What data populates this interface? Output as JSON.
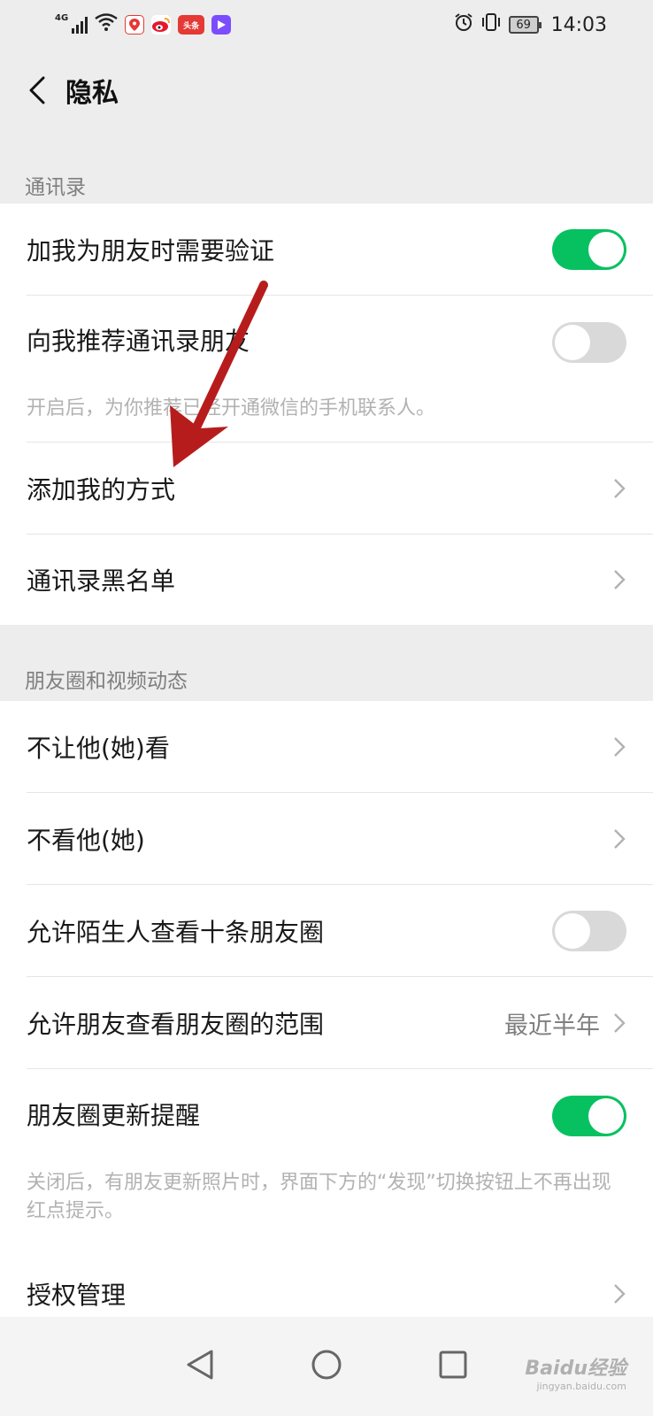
{
  "status_bar": {
    "network": "4G",
    "apps": [
      {
        "icon": "maps-app-icon",
        "color": "#e53935",
        "text": ""
      },
      {
        "icon": "weibo-app-icon",
        "color": "#f5a623",
        "text": ""
      },
      {
        "icon": "toutiao-app-icon",
        "color": "#e53935",
        "text": "头条"
      },
      {
        "icon": "video-app-icon",
        "color": "#7b4dff",
        "text": ""
      }
    ],
    "battery": "69",
    "time": "14:03"
  },
  "header": {
    "title": "隐私"
  },
  "sections": {
    "contacts": {
      "title": "通讯录",
      "rows": {
        "verify": {
          "label": "加我为朋友时需要验证",
          "toggle": "on"
        },
        "recommend": {
          "label": "向我推荐通讯录朋友",
          "toggle": "off",
          "description": "开启后，为你推荐已经开通微信的手机联系人。"
        },
        "add_methods": {
          "label": "添加我的方式"
        },
        "blacklist": {
          "label": "通讯录黑名单"
        }
      }
    },
    "moments": {
      "title": "朋友圈和视频动态",
      "rows": {
        "hide_from": {
          "label": "不让他(她)看"
        },
        "dont_see": {
          "label": "不看他(她)"
        },
        "strangers": {
          "label": "允许陌生人查看十条朋友圈",
          "toggle": "off"
        },
        "range": {
          "label": "允许朋友查看朋友圈的范围",
          "value": "最近半年"
        },
        "update_reminder": {
          "label": "朋友圈更新提醒",
          "toggle": "on",
          "description": "关闭后，有朋友更新照片时，界面下方的“发现”切换按钮上不再出现红点提示。"
        }
      }
    },
    "other": {
      "rows": {
        "auth": {
          "label": "授权管理"
        }
      }
    }
  },
  "watermark": {
    "main": "Baidu经验",
    "sub": "jingyan.baidu.com"
  },
  "colors": {
    "accent": "#07c160",
    "annotation_arrow": "#b71c1c"
  }
}
